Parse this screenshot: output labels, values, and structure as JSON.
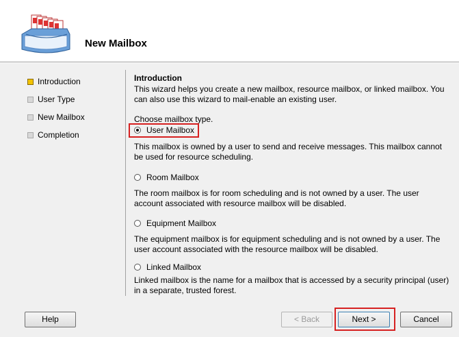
{
  "header": {
    "title": "New Mailbox",
    "icon": "mailbox-stack-icon"
  },
  "nav": {
    "items": [
      {
        "label": "Introduction",
        "active": true
      },
      {
        "label": "User Type",
        "active": false
      },
      {
        "label": "New Mailbox",
        "active": false
      },
      {
        "label": "Completion",
        "active": false
      }
    ]
  },
  "content": {
    "title": "Introduction",
    "intro": "This wizard helps you create a new mailbox, resource mailbox, or linked mailbox. You can also use this wizard to mail-enable an existing user.",
    "choose_label": "Choose mailbox type.",
    "options": [
      {
        "label": "User Mailbox",
        "checked": true,
        "description": "This mailbox is owned by a user to send and receive messages. This mailbox cannot be used for resource scheduling."
      },
      {
        "label": "Room Mailbox",
        "checked": false,
        "description": "The room mailbox is for room scheduling and is not owned by a user. The user account associated with resource mailbox will be disabled."
      },
      {
        "label": "Equipment Mailbox",
        "checked": false,
        "description": "The equipment mailbox is for equipment scheduling and is not owned by a user. The user account associated with the resource mailbox will be disabled."
      },
      {
        "label": "Linked Mailbox",
        "checked": false,
        "description": "Linked mailbox is the name for a mailbox that is accessed by a security principal (user) in a separate, trusted forest."
      }
    ]
  },
  "buttons": {
    "help": "Help",
    "back": "< Back",
    "next": "Next >",
    "cancel": "Cancel"
  },
  "colors": {
    "highlight": "#d62020",
    "active_nav": "#f2c300"
  }
}
